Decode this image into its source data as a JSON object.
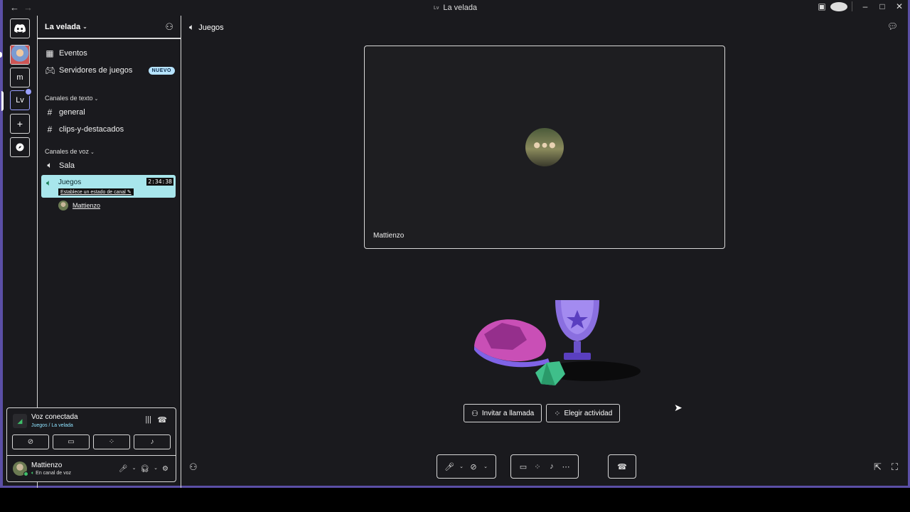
{
  "window": {
    "title": "La velada",
    "title_icon_text": "Lv",
    "nav_back": "←",
    "nav_forward": "→"
  },
  "titlebar_icons": {
    "inbox": "▣",
    "help": "?",
    "minimize": "–",
    "maximize": "□",
    "close": "✕"
  },
  "rail": {
    "home": "discord-logo",
    "server_m": "m",
    "server_lv": "Lv",
    "add": "+",
    "discover": "compass"
  },
  "server": {
    "name": "La velada",
    "items": [
      {
        "icon": "calendar-icon",
        "label": "Eventos"
      },
      {
        "icon": "gamepad-icon",
        "label": "Servidores de juegos",
        "badge": "NUEVO"
      }
    ],
    "text_category": "Canales de texto",
    "text_channels": [
      "general",
      "clips-y-destacados"
    ],
    "voice_category": "Canales de voz",
    "voice_channels": [
      "Sala"
    ],
    "active_voice": {
      "name": "Juegos",
      "timer": "2:34:38",
      "status_prompt": "Establece un estado de canal"
    },
    "member": "Mattienzo"
  },
  "voice_panel": {
    "title": "Voz conectada",
    "subtitle": "Juegos / La velada"
  },
  "user": {
    "name": "Mattienzo",
    "status": "En canal de voz"
  },
  "main": {
    "channel": "Juegos",
    "tile_name": "Mattienzo",
    "invite_button": "Invitar a llamada",
    "activity_button": "Elegir actividad"
  },
  "colors": {
    "accent_frame": "#5b4fa6",
    "active_channel_bg": "#a8e6ec",
    "badge_new_bg": "#b6e3ff",
    "online": "#3fbf6a",
    "voice_link": "#8fe3ff"
  }
}
